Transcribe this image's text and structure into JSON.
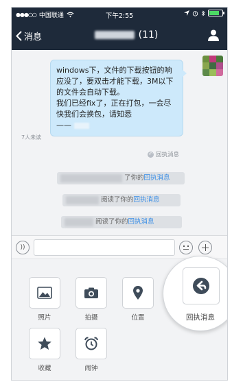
{
  "status_bar": {
    "carrier": "中国联通",
    "time": "下午2:55",
    "battery_level": 0.8
  },
  "nav": {
    "back_label": "消息",
    "title_count": "(11)"
  },
  "message": {
    "lines": [
      "windows下，文件的下载按钮的响应没了，要双击才能下载，3M以下的文件会自动下载。",
      "我们已经fix了，正在打包，一会尽快我们会换包，请知悉"
    ],
    "tail": "——"
  },
  "unread_label": "7人未读",
  "receipt_tag": "回执消息",
  "system_notices": [
    {
      "prefix": "",
      "action": "了你的",
      "link": "回执消息"
    },
    {
      "prefix": "",
      "action": "阅读了你的",
      "link": "回执消息"
    },
    {
      "prefix": "",
      "action": "阅读了你的",
      "link": "回执消息"
    }
  ],
  "panel": {
    "items": [
      {
        "label": "照片",
        "icon": "photo-icon"
      },
      {
        "label": "拍摄",
        "icon": "camera-icon"
      },
      {
        "label": "位置",
        "icon": "location-pin-icon"
      },
      {
        "label": "收藏",
        "icon": "star-icon"
      },
      {
        "label": "闹钟",
        "icon": "alarm-clock-icon"
      }
    ],
    "highlight": {
      "label": "回执消息",
      "icon": "receipt-reply-icon"
    }
  },
  "colors": {
    "nav_bg": "#1e2a3a",
    "bubble_bg": "#cde9fb",
    "link": "#3a8ee6",
    "icon_dark": "#3f4c5a"
  }
}
